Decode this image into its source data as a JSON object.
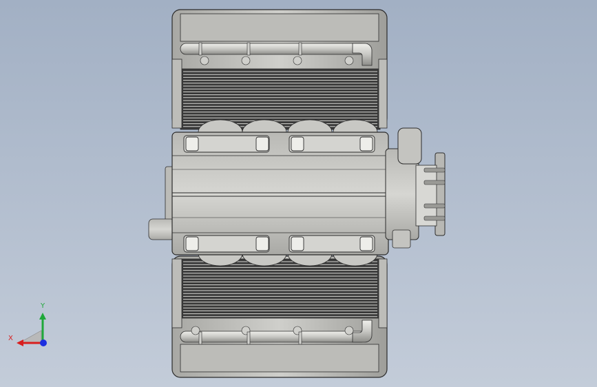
{
  "viewport": {
    "background_top": "#a2b0c4",
    "background_bottom": "#c3ccd9"
  },
  "model": {
    "body_color": "#c4c4c0",
    "edge_color": "#2b2b2b",
    "fin_dark": "#3a3a3a",
    "fin_light": "#d8d8d4"
  },
  "triad": {
    "x_label": "X",
    "y_label": "Y",
    "x_color": "#d81e1e",
    "y_color": "#1fa83a",
    "z_color": "#1c2fe0",
    "label_x_color": "#d81e1e",
    "label_y_color": "#1fa83a"
  }
}
